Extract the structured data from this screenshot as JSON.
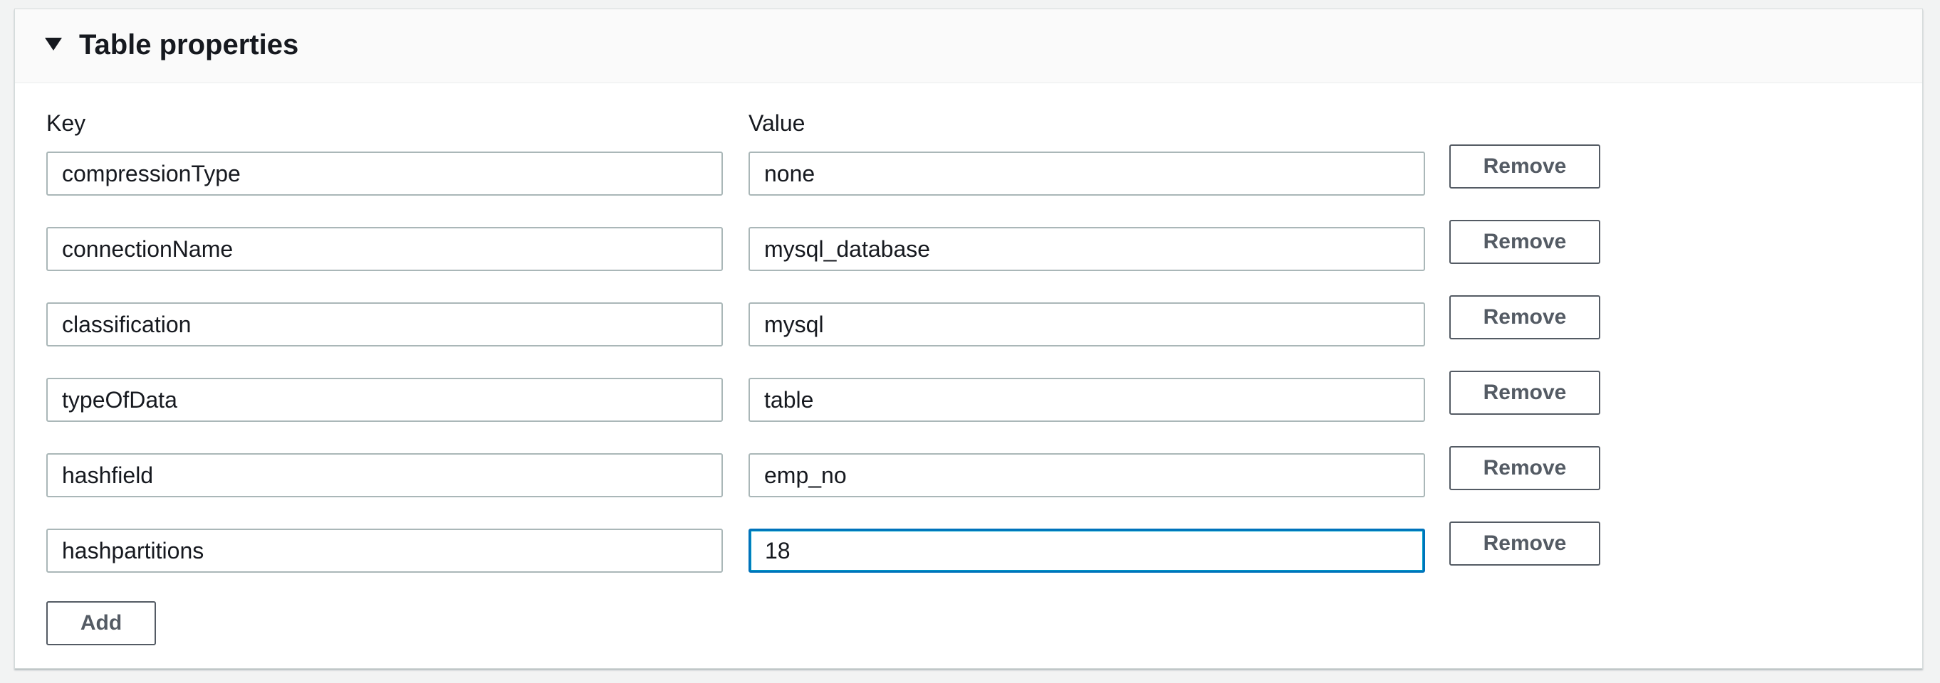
{
  "panel": {
    "title": "Table properties"
  },
  "columns": {
    "key_label": "Key",
    "value_label": "Value"
  },
  "rows": [
    {
      "key": "compressionType",
      "value": "none",
      "remove_label": "Remove"
    },
    {
      "key": "connectionName",
      "value": "mysql_database",
      "remove_label": "Remove"
    },
    {
      "key": "classification",
      "value": "mysql",
      "remove_label": "Remove"
    },
    {
      "key": "typeOfData",
      "value": "table",
      "remove_label": "Remove"
    },
    {
      "key": "hashfield",
      "value": "emp_no",
      "remove_label": "Remove"
    },
    {
      "key": "hashpartitions",
      "value": "18",
      "remove_label": "Remove"
    }
  ],
  "add_label": "Add",
  "icons": {
    "expand": "caret-down-icon"
  },
  "colors": {
    "focus_border": "#0073bb",
    "button_text": "#545b64",
    "input_border": "#aab7b8"
  }
}
